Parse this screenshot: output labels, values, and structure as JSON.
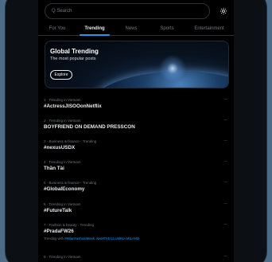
{
  "search": {
    "placeholder": "Q Search"
  },
  "tabs": [
    {
      "label": "For You"
    },
    {
      "label": "Trending"
    },
    {
      "label": "News"
    },
    {
      "label": "Sports"
    },
    {
      "label": "Entertainment"
    }
  ],
  "banner": {
    "title": "Global Trending",
    "subtitle": "The most popular posts",
    "button": "Explore"
  },
  "more_glyph": "···",
  "trends": [
    {
      "meta": "1 · Trending in Vietnam",
      "name": "#ActressJISOOonNetflix"
    },
    {
      "meta": "2 · Trending in Vietnam",
      "name": "BOYFRIEND ON DEMAND PRESSCON"
    },
    {
      "meta": "3 · Business & finance · Trending",
      "name": "#nexusUSDX"
    },
    {
      "meta": "4 · Trending in Vietnam",
      "name": "Thần Tài"
    },
    {
      "meta": "5 · Business & finance · Trending",
      "name": "#GlobalEconomy"
    },
    {
      "meta": "6 · Trending in Vietnam",
      "name": "#FutureTalk"
    },
    {
      "meta": "7 · Fashion & beauty · Trending",
      "name": "#PradaFW26",
      "related_prefix": "Trending with",
      "related_tags": "#MilanFashionWeek, NAMTAN LLUMINA MILANO"
    },
    {
      "meta": "8 · Trending in Vietnam",
      "name": ""
    }
  ],
  "colors": {
    "accent": "#1d9bf0",
    "background": "#000000",
    "text": "#e7e9ea",
    "muted": "#71767b"
  },
  "icons": {
    "search": "search-icon",
    "settings": "gear-icon",
    "more": "more-icon"
  }
}
